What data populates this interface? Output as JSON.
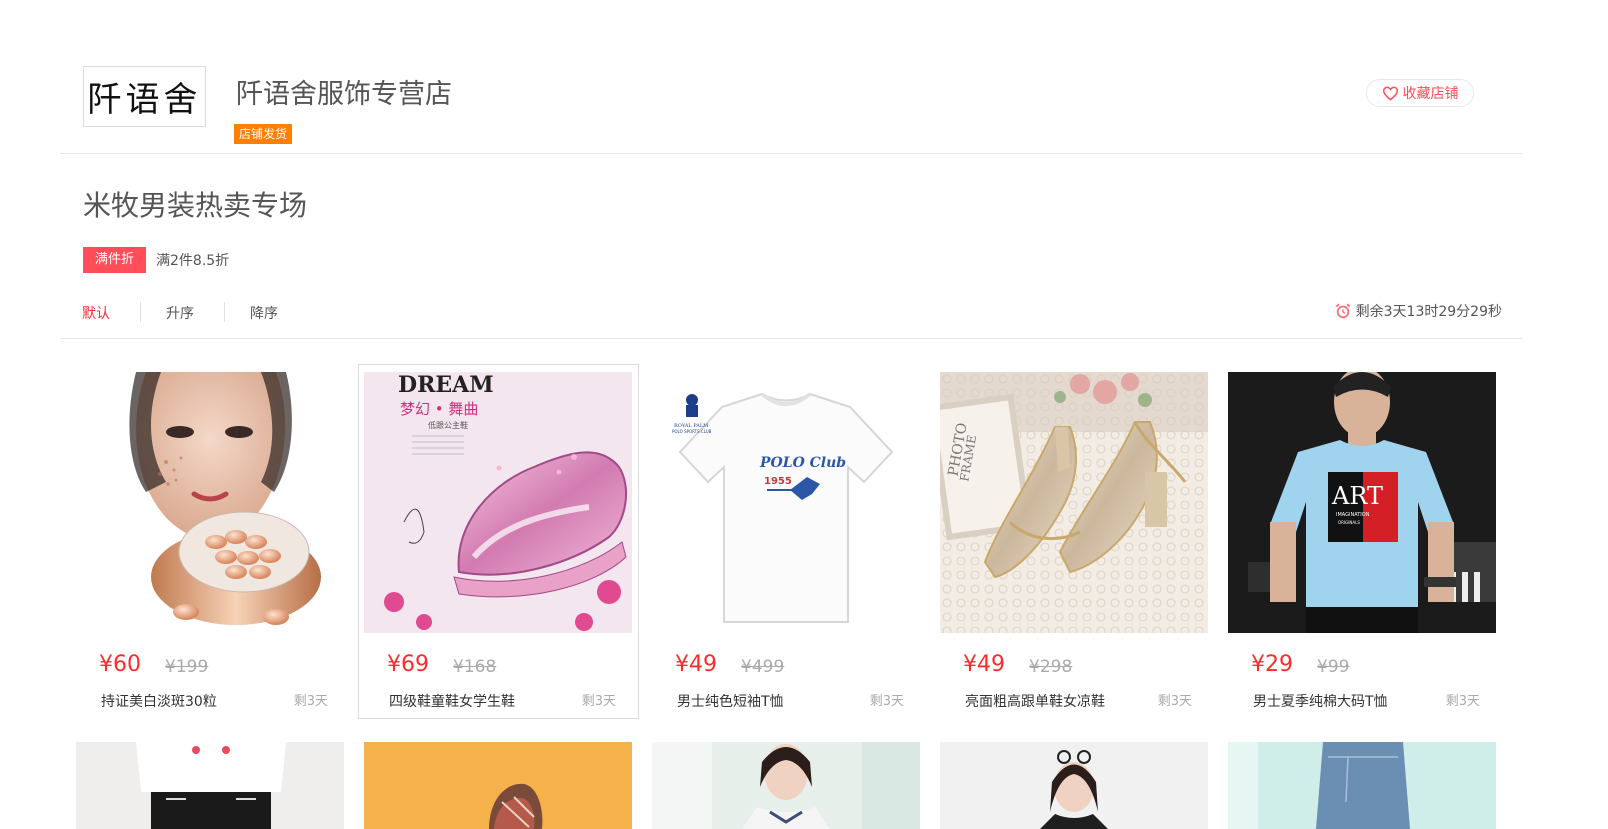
{
  "shop": {
    "logo_text": "阡语舍",
    "name": "阡语舍服饰专营店",
    "ship_badge": "店铺发货",
    "favorite_label": "收藏店铺"
  },
  "promo": {
    "title": "米牧男装热卖专场",
    "tag": "满件折",
    "rule": "满2件8.5折"
  },
  "sort": {
    "items": [
      "默认",
      "升序",
      "降序"
    ],
    "active": "默认"
  },
  "countdown": "剩余3天13时29分29秒",
  "products": [
    {
      "price": "¥60",
      "original": "¥199",
      "name": "持证美白淡斑30粒",
      "remain": "剩3天"
    },
    {
      "price": "¥69",
      "original": "¥168",
      "name": "四级鞋童鞋女学生鞋",
      "remain": "剩3天",
      "image_text": [
        "DREAM",
        "梦幻 • 舞曲",
        "低跟公主鞋"
      ]
    },
    {
      "price": "¥49",
      "original": "¥499",
      "name": "男士纯色短袖T恤",
      "remain": "剩3天",
      "image_text": [
        "ROYAL PALM",
        "POLO SPORTS CLUB",
        "POLO Club",
        "1955"
      ]
    },
    {
      "price": "¥49",
      "original": "¥298",
      "name": "亮面粗高跟单鞋女凉鞋",
      "remain": "剩3天",
      "image_text": [
        "PHOTO",
        "FRAME"
      ]
    },
    {
      "price": "¥29",
      "original": "¥99",
      "name": "男士夏季纯棉大码T恤",
      "remain": "剩3天",
      "image_text": [
        "ART",
        "IMAGINATION",
        "ORIGINALS"
      ]
    }
  ],
  "colors": {
    "accent": "#ff2a2a",
    "promo_tag": "#ff4d5a",
    "ship_badge": "#ff8000"
  }
}
